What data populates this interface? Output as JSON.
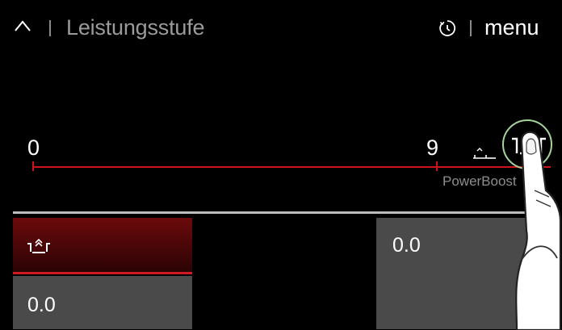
{
  "header": {
    "title": "Leistungsstufe",
    "menu_label": "menu",
    "icons": [
      "chevron-up-icon",
      "timer-icon"
    ]
  },
  "scale": {
    "min_label": "0",
    "max_label": "9",
    "boost_label": "PowerBoost"
  },
  "tiles": {
    "left_value": "0.0",
    "right_value": "0.0",
    "icon": "pot-with-steam-icon"
  },
  "colors": {
    "accent_red": "#d0121b",
    "selected_ring": "#a7d49a",
    "tile_gray": "#4a4a4a"
  }
}
